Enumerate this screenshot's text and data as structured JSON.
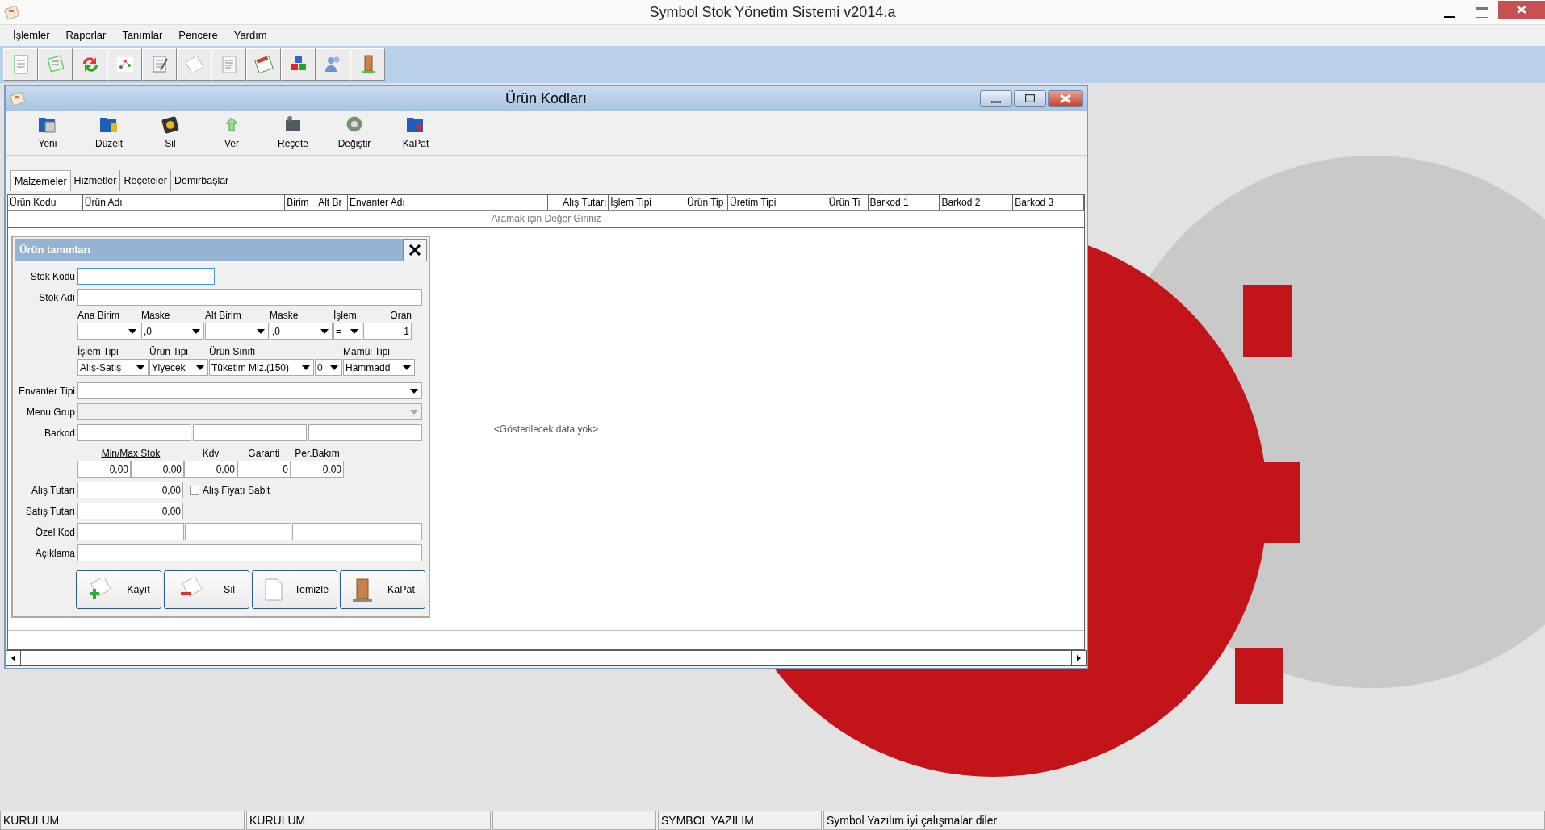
{
  "app_window": {
    "title": "Symbol Stok Yönetim Sistemi v2014.a"
  },
  "menu": [
    {
      "key": "İ",
      "after": "şlemler"
    },
    {
      "key": "R",
      "after": "aporlar"
    },
    {
      "key": "T",
      "after": "anımlar"
    },
    {
      "key": "P",
      "after": "encere"
    },
    {
      "key": "Y",
      "after": "ardım"
    }
  ],
  "child_window": {
    "title": "Ürün Kodları",
    "toolbar": [
      {
        "key": "Y",
        "after": "eni"
      },
      {
        "key": "D",
        "after": "üzelt"
      },
      {
        "key": "S",
        "after": "il"
      },
      {
        "key": "V",
        "after": "er"
      },
      {
        "before": "Reçete"
      },
      {
        "before": "Değiştir"
      },
      {
        "before": "Ka",
        "key": "P",
        "after": "at"
      }
    ],
    "tabs": [
      {
        "label": "Malzemeler",
        "selected": true
      },
      {
        "label": "Hizmetler",
        "selected": false
      },
      {
        "label": "Reçeteler",
        "selected": false
      },
      {
        "label": "Demirbaşlar",
        "selected": false
      }
    ],
    "table": {
      "columns": [
        {
          "label": "Ürün  Kodu",
          "kind": "text"
        },
        {
          "label": "Ürün Adı",
          "kind": "text"
        },
        {
          "label": "Birim",
          "kind": "text"
        },
        {
          "label": "Alt Br",
          "kind": "text"
        },
        {
          "label": "Envanter Adı",
          "kind": "text"
        },
        {
          "label": "Alış Tutarı",
          "kind": "numeric"
        },
        {
          "label": "İşlem Tipi",
          "kind": "text"
        },
        {
          "label": "Ürün Tip",
          "kind": "text"
        },
        {
          "label": "Üretim Tipi",
          "kind": "text"
        },
        {
          "label": "Ürün Ti",
          "kind": "text"
        },
        {
          "label": "Barkod 1",
          "kind": "text"
        },
        {
          "label": "Barkod 2",
          "kind": "text"
        },
        {
          "label": "Barkod 3",
          "kind": "text"
        }
      ],
      "filter_placeholder": "Aramak için Değer Giriniz",
      "empty_message": "<Gösterilecek data yok>"
    },
    "product_form": {
      "title": "Ürün tanımları",
      "stock_code": {
        "label": "Stok Kodu",
        "focused": true
      },
      "stock_name": {
        "label": "Stok Adı"
      },
      "units": [
        {
          "label": "Ana Birim",
          "kind": "combo"
        },
        {
          "label": "Maske",
          "kind": "combo",
          "value": ",0"
        },
        {
          "label": "Alt Birim",
          "kind": "combo"
        },
        {
          "label": "Maske",
          "kind": "combo",
          "value": ",0"
        },
        {
          "label": "İşlem",
          "kind": "combo",
          "value": "="
        },
        {
          "label": "Oran",
          "kind": "number",
          "value": "1"
        }
      ],
      "types": [
        {
          "label": "İşlem Tipi",
          "value": "Alış-Satış"
        },
        {
          "label": "Ürün Tipi",
          "value": "Yiyecek"
        },
        {
          "label": "Ürün Sınıfı",
          "value": "Tüketim Mlz.(150)"
        },
        {
          "value": "0"
        },
        {
          "label": "Mamül Tipi",
          "value": "Hammadd"
        }
      ],
      "inventory_type": {
        "label": "Envanter Tipi",
        "disabled": false
      },
      "menu_group": {
        "label": "Menu Grup",
        "disabled": true
      },
      "barcode": {
        "label": "Barkod"
      },
      "limits": [
        {
          "label": "Min/Max Stok",
          "kind": "link",
          "values": [
            "0,00",
            "0,00"
          ]
        },
        {
          "label": "Kdv",
          "kind": "text",
          "values": [
            "0,00"
          ]
        },
        {
          "label": "Garanti",
          "kind": "text",
          "values": [
            "0"
          ]
        },
        {
          "label": "Per.Bakım",
          "kind": "text",
          "values": [
            "0,00"
          ]
        }
      ],
      "purchase_amount": {
        "label": "Alış Tutarı",
        "value": "0,00"
      },
      "fixed_price": {
        "label": "Alış Fiyatı Sabit",
        "checked": false
      },
      "sale_amount": {
        "label": "Satış Tutarı",
        "value": "0,00"
      },
      "special_code": {
        "label": "Özel Kod"
      },
      "description": {
        "label": "Açıklama"
      },
      "buttons": [
        {
          "key": "K",
          "after": "ayıt"
        },
        {
          "key": "S",
          "after": "il"
        },
        {
          "key": "T",
          "after": "emizle"
        },
        {
          "before": "Ka",
          "key": "P",
          "after": "at"
        }
      ]
    }
  },
  "status_bar": {
    "left": [
      "KURULUM",
      "KURULUM"
    ],
    "right": [
      "SYMBOL YAZILIM",
      "Symbol Yazılım iyi çalışmalar diler"
    ]
  }
}
